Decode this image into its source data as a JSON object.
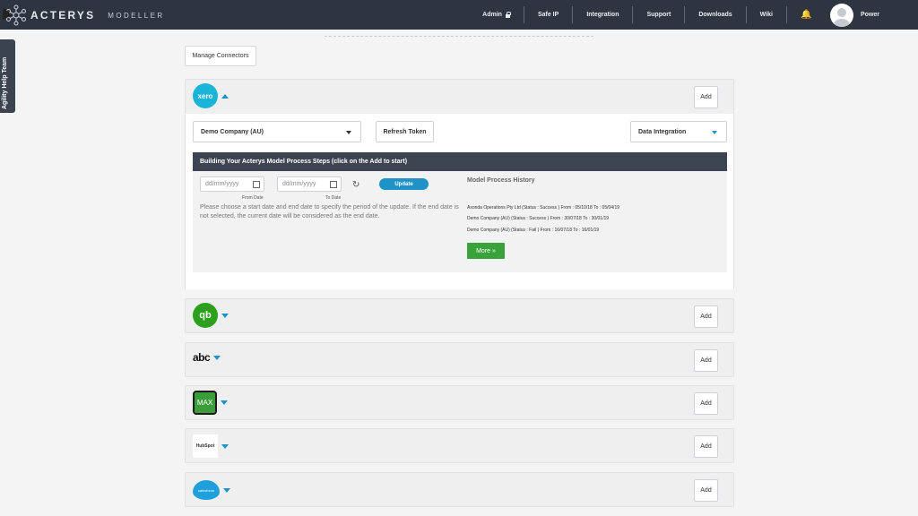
{
  "header": {
    "brand_name": "ACTERYS",
    "brand_sub": "MODELLER",
    "nav": [
      {
        "label": "Admin"
      },
      {
        "label": "Safe IP"
      },
      {
        "label": "Integration"
      },
      {
        "label": "Support"
      },
      {
        "label": "Downloads"
      },
      {
        "label": "Wiki"
      }
    ],
    "user_name": "Power"
  },
  "help_tab": "Agility Help Team",
  "manage_connectors": "Manage Connectors",
  "add_label": "Add",
  "xero": {
    "logo_text": "xero",
    "company_select": "Demo Company (AU)",
    "refresh_token": "Refresh Token",
    "mode_select": "Data Integration",
    "steps_title": "Building Your Acterys Model Process Steps (click on the Add to start)",
    "from_placeholder": "dd/mm/yyyy",
    "to_placeholder": "dd/mm/yyyy",
    "from_label": "From Date",
    "to_label": "To Date",
    "update_label": "Update",
    "hint": "Please choose a start date and end date to specify the period of the update. If the end date is not selected, the current date will be considered as the end date.",
    "history_title": "Model Process History",
    "history": [
      "Axonda Operations Pty Ltd (Status : Success )   From : 05/10/18 To : 05/04/19",
      "Demo Company (AU) (Status : Success )   From : 30/07/18 To : 30/01/19",
      "Demo Company (AU) (Status : Fail )   From : 16/07/18 To : 16/01/19"
    ],
    "more_label": "More »"
  },
  "connectors": [
    {
      "name": "quickbooks",
      "logo_text": "qb"
    },
    {
      "name": "abc",
      "logo_text": "abc"
    },
    {
      "name": "max",
      "logo_text": "MAX"
    },
    {
      "name": "hubspot",
      "logo_text": "HubSpot"
    },
    {
      "name": "salesforce",
      "logo_text": "salesforce"
    }
  ]
}
